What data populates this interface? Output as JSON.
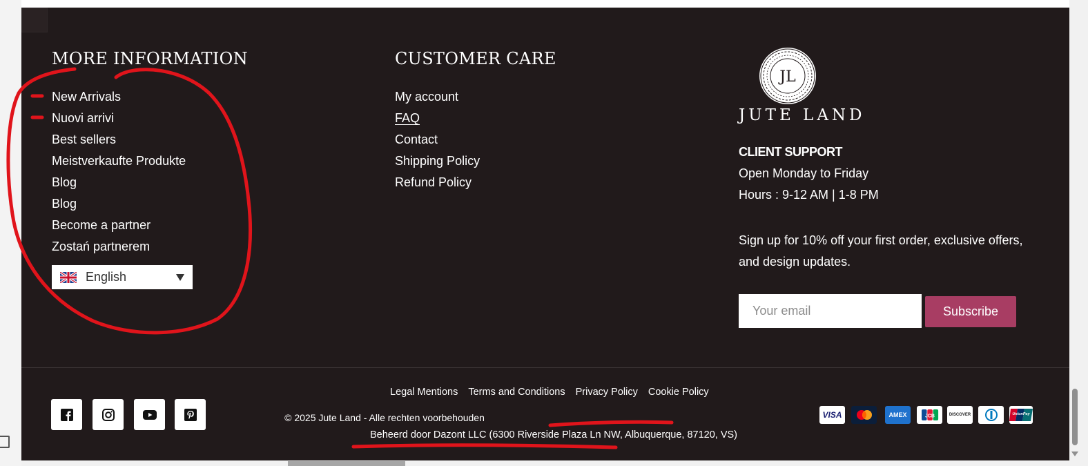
{
  "more_info": {
    "title": "MORE INFORMATION",
    "links": [
      "New Arrivals",
      "Nuovi arrivi",
      "Best sellers",
      "Meistverkaufte Produkte",
      "Blog",
      "Blog",
      "Become a partner",
      "Zostań partnerem"
    ]
  },
  "language": {
    "selected": "English",
    "flag_icon": "uk-flag-icon"
  },
  "customer_care": {
    "title": "CUSTOMER CARE",
    "links": [
      "My account",
      "FAQ",
      "Contact",
      "Shipping Policy",
      "Refund Policy"
    ]
  },
  "brand": {
    "logo_letters": "JL",
    "name": "JUTE LAND"
  },
  "support": {
    "title": "CLIENT SUPPORT",
    "days": "Open Monday to Friday",
    "hours": "Hours : 9-12 AM | 1-8 PM"
  },
  "newsletter": {
    "text": "Sign up for 10% off your first order, exclusive offers, and design updates.",
    "placeholder": "Your email",
    "button": "Subscribe"
  },
  "social_icons": [
    "facebook-icon",
    "instagram-icon",
    "youtube-icon",
    "pinterest-icon"
  ],
  "legal_links": [
    "Legal Mentions",
    "Terms and Conditions",
    "Privacy Policy",
    "Cookie Policy"
  ],
  "copyright": "© 2025 Jute Land - Alle rechten voorbehouden",
  "operated_by": "Beheerd door Dazont LLC (6300 Riverside Plaza Ln NW, Albuquerque, 87120, VS)",
  "payments": [
    {
      "name": "visa",
      "label": "VISA"
    },
    {
      "name": "mastercard",
      "label": ""
    },
    {
      "name": "amex",
      "label": "AMEX"
    },
    {
      "name": "jcb",
      "label": "JCB"
    },
    {
      "name": "discover",
      "label": "DISCOVER"
    },
    {
      "name": "diners",
      "label": ""
    },
    {
      "name": "unionpay",
      "label": "UnionPay"
    }
  ],
  "colors": {
    "footer_bg": "#211a1b",
    "subscribe_bg": "#a83d63",
    "annotation_red": "#e0141b"
  }
}
